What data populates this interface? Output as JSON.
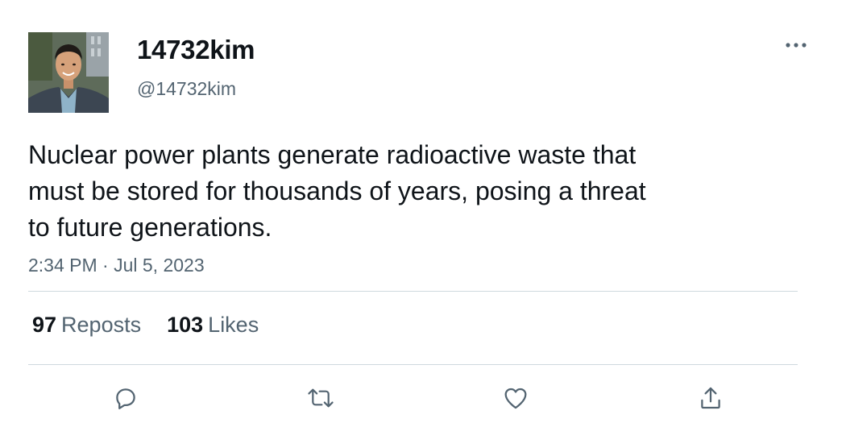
{
  "user": {
    "display_name": "14732kim",
    "handle": "@14732kim"
  },
  "tweet": {
    "text": "Nuclear power plants generate radioactive waste that\nmust be stored for thousands of years, posing a threat\nto future generations.",
    "timestamp": "2:34 PM · Jul 5, 2023"
  },
  "stats": {
    "reposts_count": "97",
    "reposts_label": "Reposts",
    "likes_count": "103",
    "likes_label": "Likes"
  },
  "actions": [
    "reply-icon",
    "repost-icon",
    "like-icon",
    "share-icon"
  ],
  "colors": {
    "text_primary": "#0f1419",
    "text_secondary": "#536471",
    "divider": "#cfd9de",
    "icon": "#536471"
  }
}
